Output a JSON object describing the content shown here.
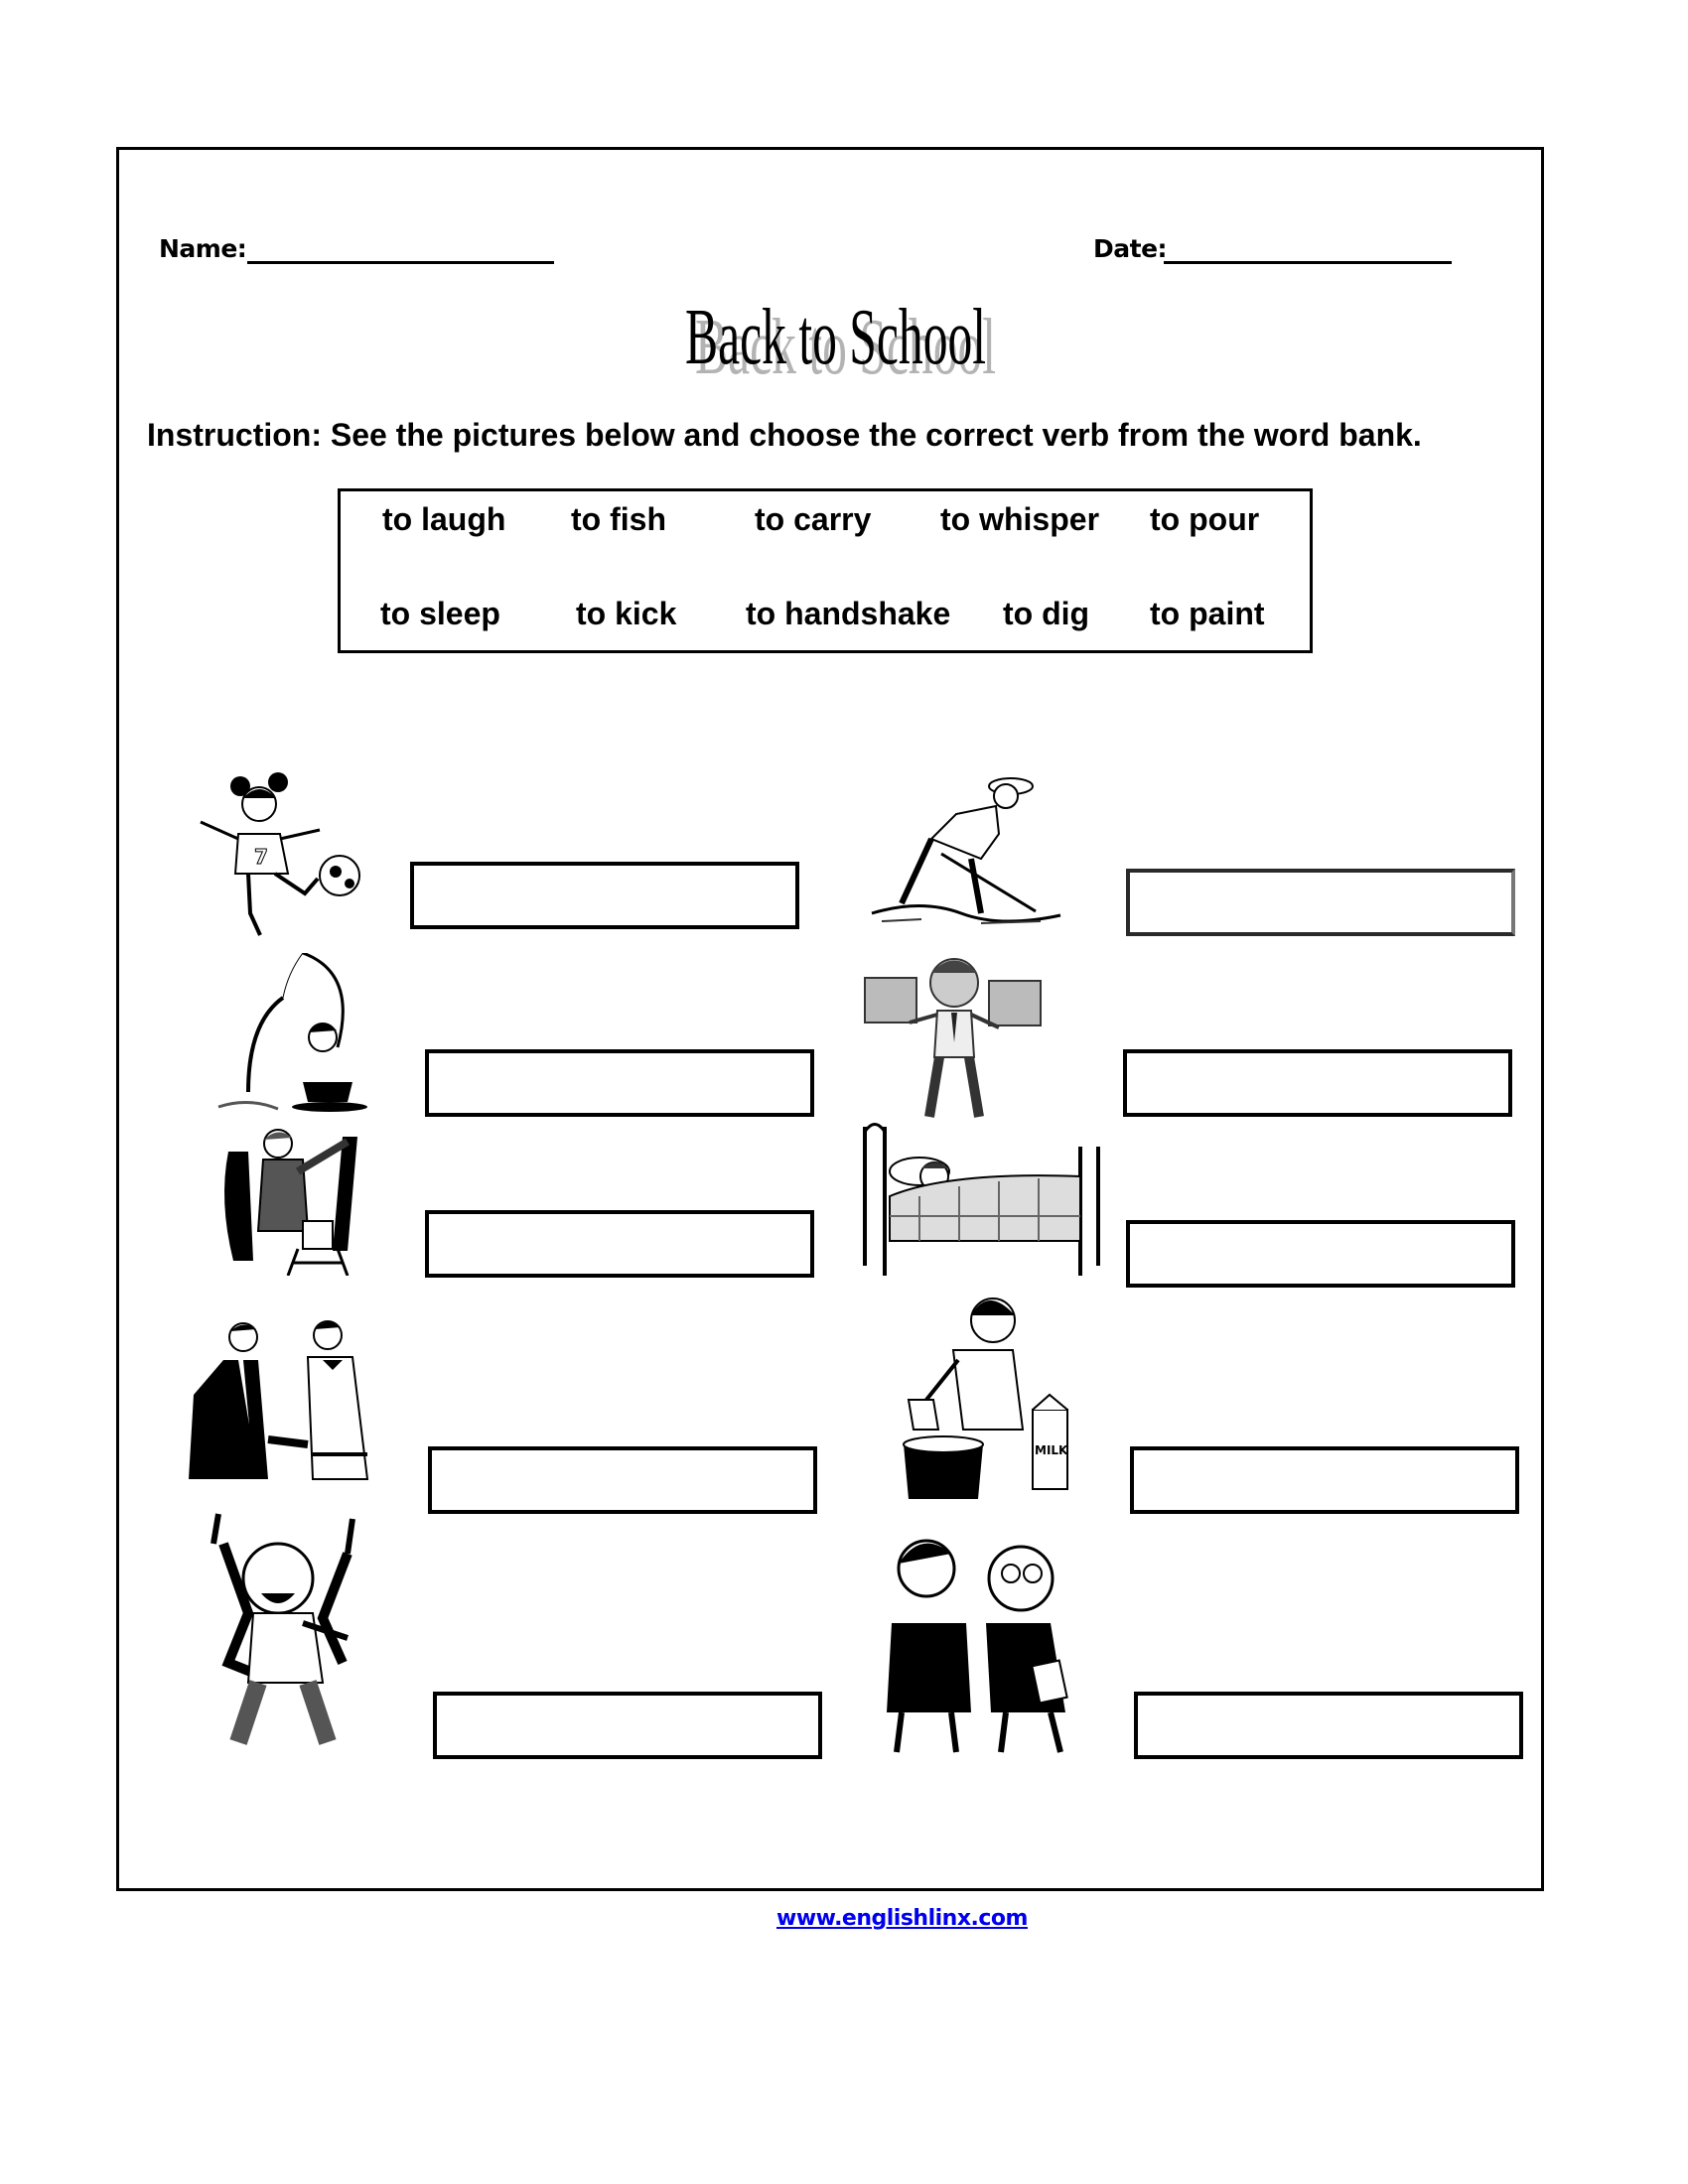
{
  "header": {
    "name_label": "Name:",
    "date_label": "Date:"
  },
  "title": "Back to School",
  "instruction": "Instruction: See the pictures below and choose the correct verb from the word bank.",
  "word_bank": {
    "row1": [
      "to laugh",
      "to fish",
      "to carry",
      "to whisper",
      "to pour"
    ],
    "row2": [
      "to sleep",
      "to kick",
      "to handshake",
      "to dig",
      "to paint"
    ]
  },
  "pictures": [
    {
      "id": "kick",
      "icon": "girl-kicking-ball-icon"
    },
    {
      "id": "dig",
      "icon": "man-digging-icon"
    },
    {
      "id": "fish",
      "icon": "boy-fishing-icon"
    },
    {
      "id": "carry",
      "icon": "man-carrying-boxes-icon"
    },
    {
      "id": "paint",
      "icon": "man-painting-icon"
    },
    {
      "id": "sleep",
      "icon": "person-sleeping-icon"
    },
    {
      "id": "handshake",
      "icon": "men-shaking-hands-icon"
    },
    {
      "id": "pour",
      "icon": "boy-pouring-milk-icon",
      "carton_text": "MILK"
    },
    {
      "id": "laugh",
      "icon": "man-laughing-icon"
    },
    {
      "id": "whisper",
      "icon": "men-whispering-icon"
    }
  ],
  "answers": [
    "",
    "",
    "",
    "",
    "",
    "",
    "",
    "",
    "",
    ""
  ],
  "footer": {
    "link_text": "www.englishlinx.com"
  }
}
